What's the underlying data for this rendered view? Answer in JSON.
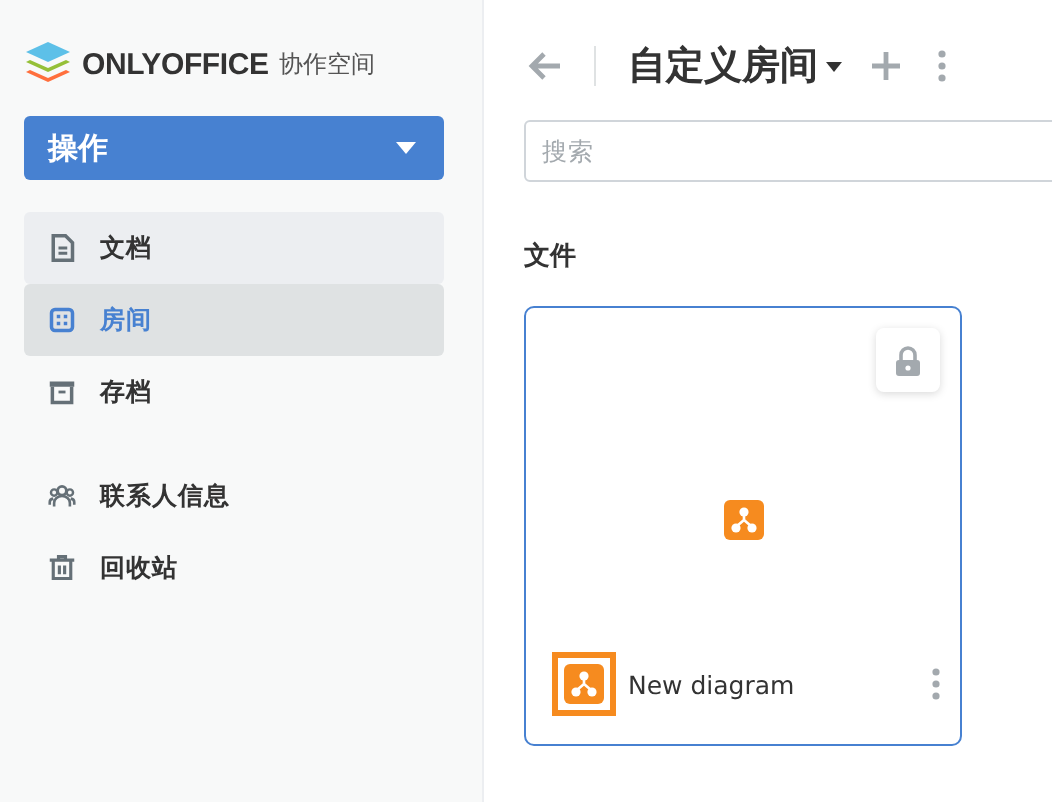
{
  "logo": {
    "brand": "ONLYOFFICE",
    "product": "协作空间"
  },
  "action_button": {
    "label": "操作"
  },
  "sidebar": {
    "items": [
      {
        "kind": "document",
        "label": "文档",
        "selected": false,
        "hovered": true
      },
      {
        "kind": "rooms",
        "label": "房间",
        "selected": true,
        "hovered": false
      },
      {
        "kind": "archive",
        "label": "存档",
        "selected": false,
        "hovered": false
      },
      {
        "kind": "contacts",
        "label": "联系人信息",
        "selected": false,
        "hovered": false
      },
      {
        "kind": "trash",
        "label": "回收站",
        "selected": false,
        "hovered": false
      }
    ]
  },
  "header": {
    "title": "自定义房间"
  },
  "search": {
    "placeholder": "搜索"
  },
  "section": {
    "title": "文件"
  },
  "files": [
    {
      "name": "New diagram",
      "locked": true
    }
  ]
}
